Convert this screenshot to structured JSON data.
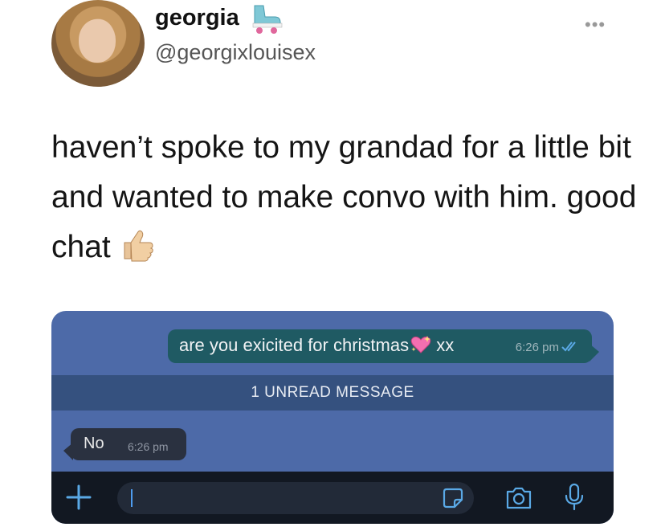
{
  "tweet": {
    "display_name": "georgia",
    "handle": "@georgixlouisex",
    "text": "haven’t spoke to my grandad for a little bit and wanted to make convo with him. good chat",
    "icons": {
      "name_emoji": "roller-skate-icon",
      "text_emoji": "thumbs-up-icon",
      "menu": "more-icon"
    }
  },
  "chat": {
    "outgoing": {
      "text": "are you exicited for christmas",
      "suffix": "xx",
      "time": "6:26 pm",
      "emoji": "sparkling-heart-icon",
      "status_icon": "double-check-icon"
    },
    "unread_banner": "1 UNREAD MESSAGE",
    "incoming": {
      "text": "No",
      "time": "6:26 pm"
    },
    "input": {
      "value": "",
      "placeholder": ""
    },
    "colors": {
      "background": "#4d6aa8",
      "outgoing_bubble": "#1f5a63",
      "incoming_bubble": "#2a3140",
      "banner": "#35517f",
      "input_bar": "#121822",
      "accent": "#4e9cf0"
    }
  }
}
